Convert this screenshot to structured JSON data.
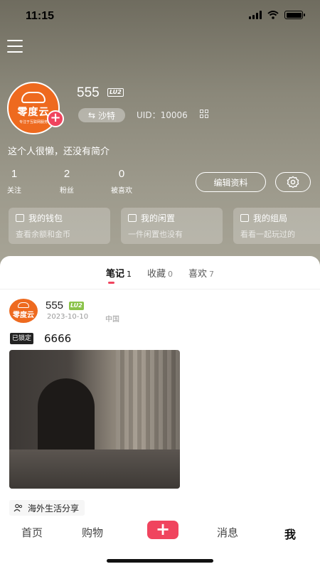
{
  "status_bar": {
    "time": "11:15"
  },
  "profile": {
    "avatar_brand": "零度云",
    "avatar_slogan": "专注于互联网服务",
    "username": "555",
    "level": "LU2",
    "location": "沙特",
    "uid": "UID：10006",
    "bio": "这个人很懒，还没有简介",
    "stats": [
      {
        "num": "1",
        "label": "关注"
      },
      {
        "num": "2",
        "label": "粉丝"
      },
      {
        "num": "0",
        "label": "被喜欢"
      }
    ],
    "edit_label": "编辑资料"
  },
  "cards": [
    {
      "title": "我的钱包",
      "sub": "查看余额和金币"
    },
    {
      "title": "我的闲置",
      "sub": "一件闲置也没有"
    },
    {
      "title": "我的组局",
      "sub": "看看一起玩过的"
    }
  ],
  "tabs": [
    {
      "label": "笔记",
      "count": "1"
    },
    {
      "label": "收藏",
      "count": "0"
    },
    {
      "label": "喜欢",
      "count": "7"
    }
  ],
  "post": {
    "avatar_brand": "零度云",
    "author": "555",
    "level": "LU2",
    "date": "2023-10-10",
    "region": "中国",
    "locked_label": "已锁定",
    "title": "6666",
    "tag": "海外生活分享"
  },
  "tabbar": {
    "home": "首页",
    "shop": "购物",
    "publish": "+",
    "messages": "消息",
    "me": "我"
  },
  "colors": {
    "accent": "#f0445e",
    "brand_orange": "#ee6a1f",
    "header_bg": "#8b887a"
  }
}
